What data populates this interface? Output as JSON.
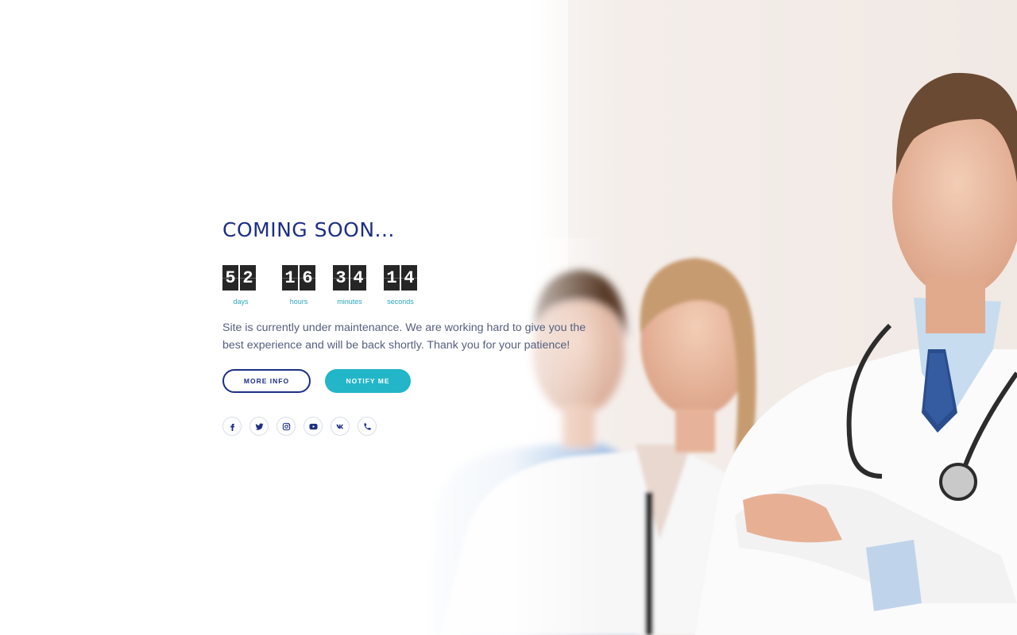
{
  "page": {
    "title": "COMING SOON...",
    "description": "Site is currently under maintenance. We are working hard to give you the best experience and will be back shortly. Thank you for your patience!"
  },
  "countdown": [
    {
      "digits": [
        "5",
        "2"
      ],
      "label": "days"
    },
    {
      "digits": [
        "1",
        "6"
      ],
      "label": "hours"
    },
    {
      "digits": [
        "3",
        "4"
      ],
      "label": "minutes"
    },
    {
      "digits": [
        "1",
        "4"
      ],
      "label": "seconds"
    }
  ],
  "buttons": {
    "more_info": "MORE INFO",
    "notify_me": "NOTIFY ME"
  },
  "socials": [
    {
      "icon": "facebook-icon"
    },
    {
      "icon": "twitter-icon"
    },
    {
      "icon": "instagram-icon"
    },
    {
      "icon": "youtube-icon"
    },
    {
      "icon": "vk-icon"
    },
    {
      "icon": "phone-icon"
    }
  ],
  "colors": {
    "title": "#1c2f86",
    "accent": "#22b6c8",
    "digit_bg": "#262626",
    "text": "#556080"
  }
}
